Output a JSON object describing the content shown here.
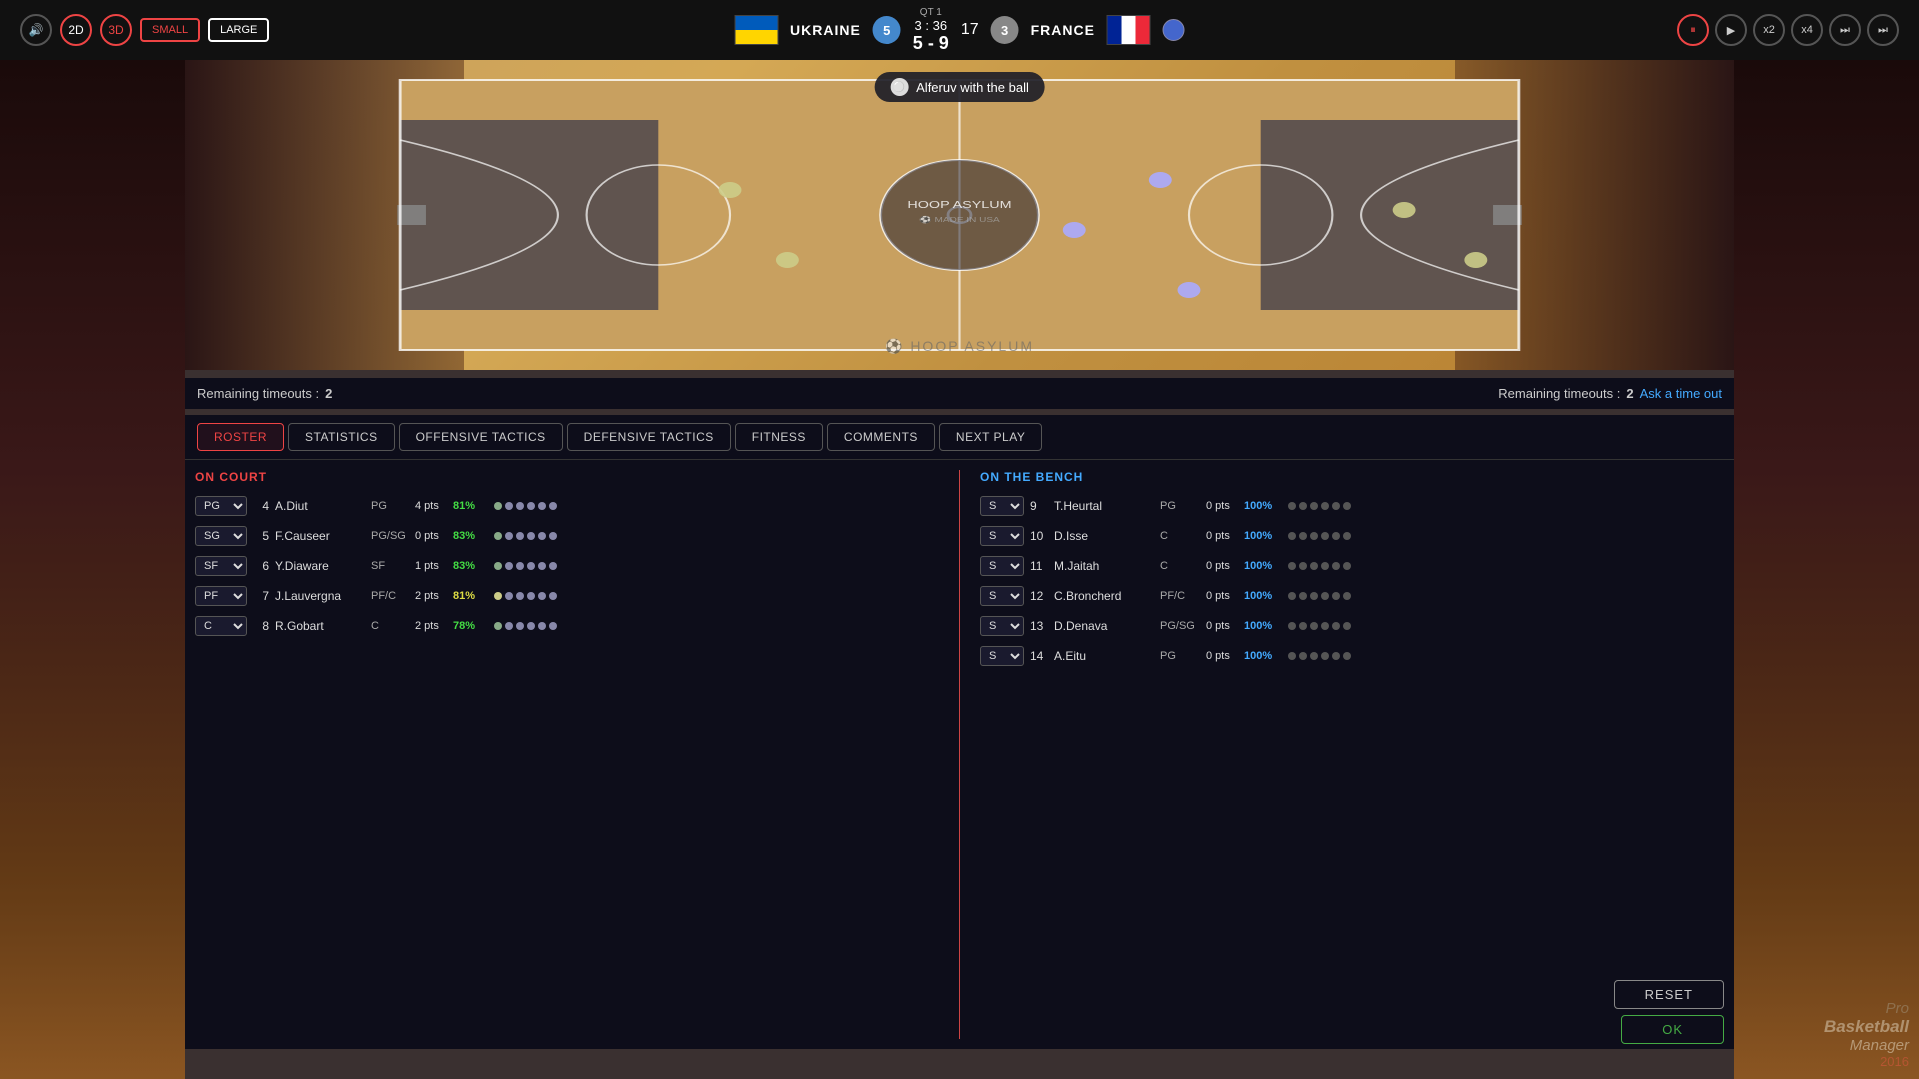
{
  "topbar": {
    "sound_btn": "🔊",
    "btn_2d": "2D",
    "btn_3d": "3D",
    "btn_small": "SMALL",
    "btn_large": "LARGE",
    "team1": {
      "name": "UKRAINE",
      "score": "5",
      "badge": "5"
    },
    "match": {
      "qt_label": "QT",
      "qt_value": "1",
      "time": "3 : 36",
      "vs_score": "5 - 9",
      "center_num": "17"
    },
    "team2": {
      "name": "FRANCE",
      "score": "3",
      "badge": "3"
    },
    "controls": {
      "pause": "⏸",
      "play": "▶",
      "x2": "x2",
      "x4": "x4",
      "skip": "⏭",
      "end": "⏭⏭"
    }
  },
  "balloon": {
    "text": "Alferuv with the ball"
  },
  "timeout_left": {
    "label": "Remaining timeouts :",
    "value": "2"
  },
  "timeout_right": {
    "label": "Remaining timeouts :",
    "value": "2",
    "link": "Ask a time out"
  },
  "tabs": [
    {
      "id": "roster",
      "label": "ROSTER",
      "active": true
    },
    {
      "id": "statistics",
      "label": "STATISTICS",
      "active": false
    },
    {
      "id": "offensive",
      "label": "OFFENSIVE TACTICS",
      "active": false
    },
    {
      "id": "defensive",
      "label": "DEFENSIVE TACTICS",
      "active": false
    },
    {
      "id": "fitness",
      "label": "FITNESS",
      "active": false
    },
    {
      "id": "comments",
      "label": "COMMENTS",
      "active": false
    },
    {
      "id": "nextplay",
      "label": "NEXT PLAY",
      "active": false
    }
  ],
  "on_court": {
    "title": "ON COURT",
    "players": [
      {
        "pos": "PG",
        "num": "4",
        "name": "A.Diut",
        "role": "PG",
        "pts": "4 pts",
        "fitness": "81%",
        "fitness_color": "green"
      },
      {
        "pos": "SG",
        "num": "5",
        "name": "F.Causeer",
        "role": "PG/SG",
        "pts": "0 pts",
        "fitness": "83%",
        "fitness_color": "green"
      },
      {
        "pos": "SF",
        "num": "6",
        "name": "Y.Diaware",
        "role": "SF",
        "pts": "1 pts",
        "fitness": "83%",
        "fitness_color": "green"
      },
      {
        "pos": "PF",
        "num": "7",
        "name": "J.Lauvergna",
        "role": "PF/C",
        "pts": "2 pts",
        "fitness": "81%",
        "fitness_color": "yellow"
      },
      {
        "pos": "C",
        "num": "8",
        "name": "R.Gobart",
        "role": "C",
        "pts": "2 pts",
        "fitness": "78%",
        "fitness_color": "green"
      }
    ]
  },
  "on_bench": {
    "title": "ON THE BENCH",
    "players": [
      {
        "sel": "S",
        "num": "9",
        "name": "T.Heurtal",
        "role": "PG",
        "pts": "0 pts",
        "fitness": "100%"
      },
      {
        "sel": "S",
        "num": "10",
        "name": "D.Isse",
        "role": "C",
        "pts": "0 pts",
        "fitness": "100%"
      },
      {
        "sel": "S",
        "num": "11",
        "name": "M.Jaitah",
        "role": "C",
        "pts": "0 pts",
        "fitness": "100%"
      },
      {
        "sel": "S",
        "num": "12",
        "name": "C.Broncherd",
        "role": "PF/C",
        "pts": "0 pts",
        "fitness": "100%"
      },
      {
        "sel": "S",
        "num": "13",
        "name": "D.Denava",
        "role": "PG/SG",
        "pts": "0 pts",
        "fitness": "100%"
      },
      {
        "sel": "S",
        "num": "14",
        "name": "A.Eitu",
        "role": "PG",
        "pts": "0 pts",
        "fitness": "100%"
      }
    ]
  },
  "buttons": {
    "reset": "RESET",
    "ok": "OK"
  },
  "logo": {
    "line1": "Pro",
    "line2": "Basketball",
    "line3": "Manager",
    "year": "2016"
  }
}
